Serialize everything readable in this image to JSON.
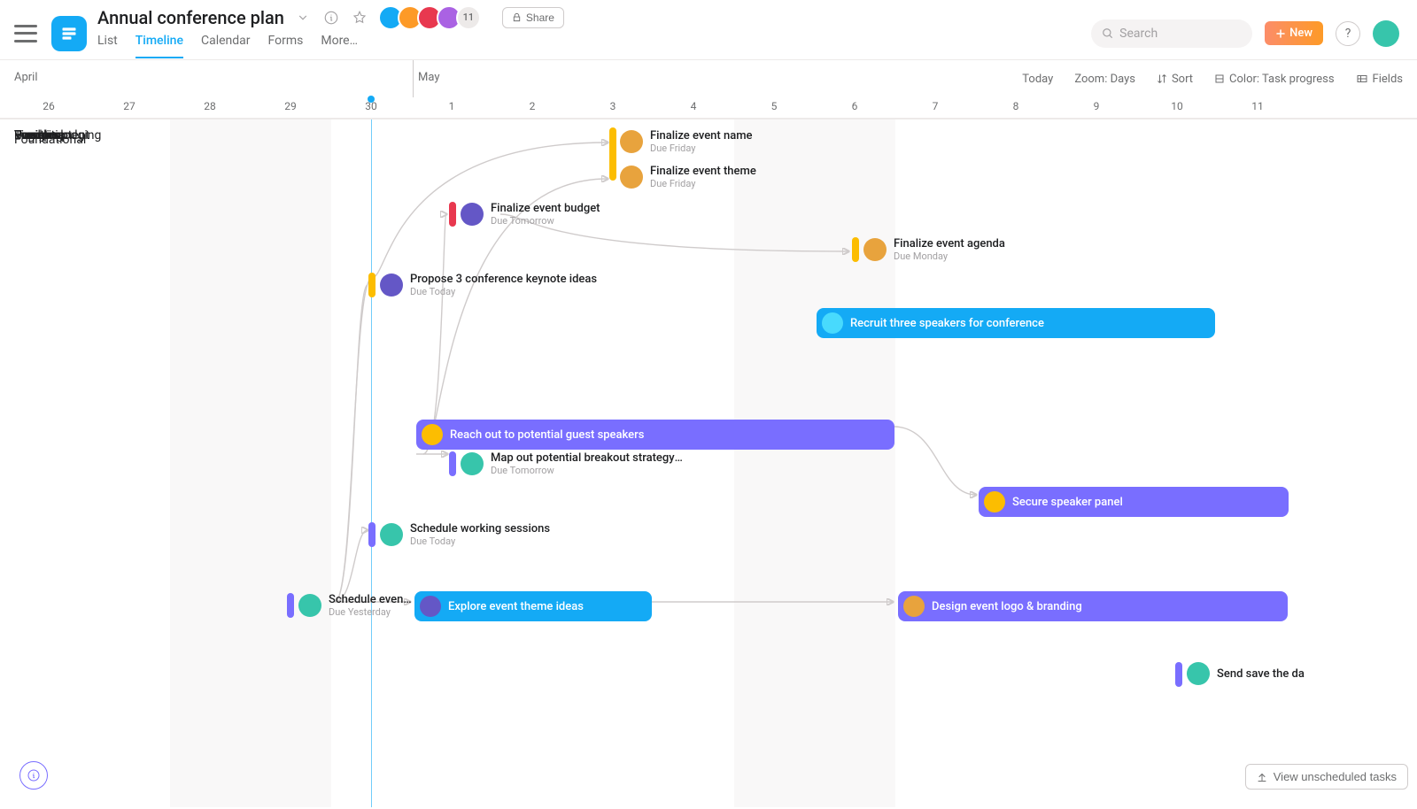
{
  "project": {
    "title": "Annual conference plan"
  },
  "share_label": "Share",
  "new_label": "New",
  "search_placeholder": "Search",
  "avatar_overflow": "11",
  "tabs": [
    "List",
    "Timeline",
    "Calendar",
    "Forms",
    "More…"
  ],
  "active_tab": 1,
  "months": {
    "april": "April",
    "may": "May"
  },
  "toolbar": {
    "today": "Today",
    "zoom": "Zoom: Days",
    "sort": "Sort",
    "color": "Color: Task progress",
    "fields": "Fields"
  },
  "dates": [
    "26",
    "27",
    "28",
    "29",
    "30",
    "1",
    "2",
    "3",
    "4",
    "5",
    "6",
    "7",
    "8",
    "9",
    "10",
    "11"
  ],
  "sections": [
    "Foundational",
    "Travel + lodging",
    "Vendors",
    "Event content",
    "Logistics",
    "Final prep",
    "Branding",
    "Design",
    "Promotion"
  ],
  "tasks": {
    "finalize_name": {
      "title": "Finalize event name",
      "due": "Due Friday"
    },
    "finalize_theme": {
      "title": "Finalize event theme",
      "due": "Due Friday"
    },
    "finalize_budget": {
      "title": "Finalize event budget",
      "due": "Due Tomorrow"
    },
    "finalize_agenda": {
      "title": "Finalize event agenda",
      "due": "Due Monday"
    },
    "propose_keynote": {
      "title": "Propose 3 conference keynote ideas",
      "due": "Due Today"
    },
    "recruit_speakers": {
      "title": "Recruit three speakers for conference"
    },
    "reach_out_speakers": {
      "title": "Reach out to potential guest speakers"
    },
    "map_breakout": {
      "title": "Map out potential breakout strategy top…",
      "due": "Due Tomorrow"
    },
    "secure_panel": {
      "title": "Secure speaker panel"
    },
    "schedule_sessions": {
      "title": "Schedule working sessions",
      "due": "Due Today"
    },
    "schedule_event": {
      "title": "Schedule event …",
      "due": "Due Yesterday"
    },
    "explore_theme": {
      "title": "Explore event theme ideas"
    },
    "design_logo": {
      "title": "Design event logo & branding"
    },
    "send_save_date": {
      "title": "Send save the da"
    }
  },
  "unscheduled_btn": "View unscheduled tasks",
  "colors": {
    "yellow": "#fcbd01",
    "red": "#e8384f",
    "purple": "#796eff",
    "blue": "#14aaf5",
    "teal": "#37c5ab"
  },
  "avatar_colors": [
    "#14aaf5",
    "#fd9a27",
    "#e8384f",
    "#37c5ab",
    "#aa62e3"
  ]
}
